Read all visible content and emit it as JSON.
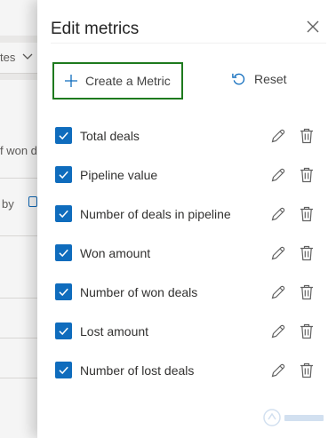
{
  "background": {
    "filter_text": "tes",
    "fragment_text": "f won d",
    "by_text": "by"
  },
  "panel": {
    "title": "Edit metrics",
    "create_label": "Create a Metric",
    "reset_label": "Reset"
  },
  "metrics": [
    {
      "label": "Total deals",
      "checked": true
    },
    {
      "label": "Pipeline value",
      "checked": true
    },
    {
      "label": "Number of deals in pipeline",
      "checked": true
    },
    {
      "label": "Won amount",
      "checked": true
    },
    {
      "label": "Number of won deals",
      "checked": true
    },
    {
      "label": "Lost amount",
      "checked": true
    },
    {
      "label": "Number of lost deals",
      "checked": true
    }
  ],
  "colors": {
    "checkbox": "#0f6cbd",
    "create_border": "#1e7a1e"
  }
}
